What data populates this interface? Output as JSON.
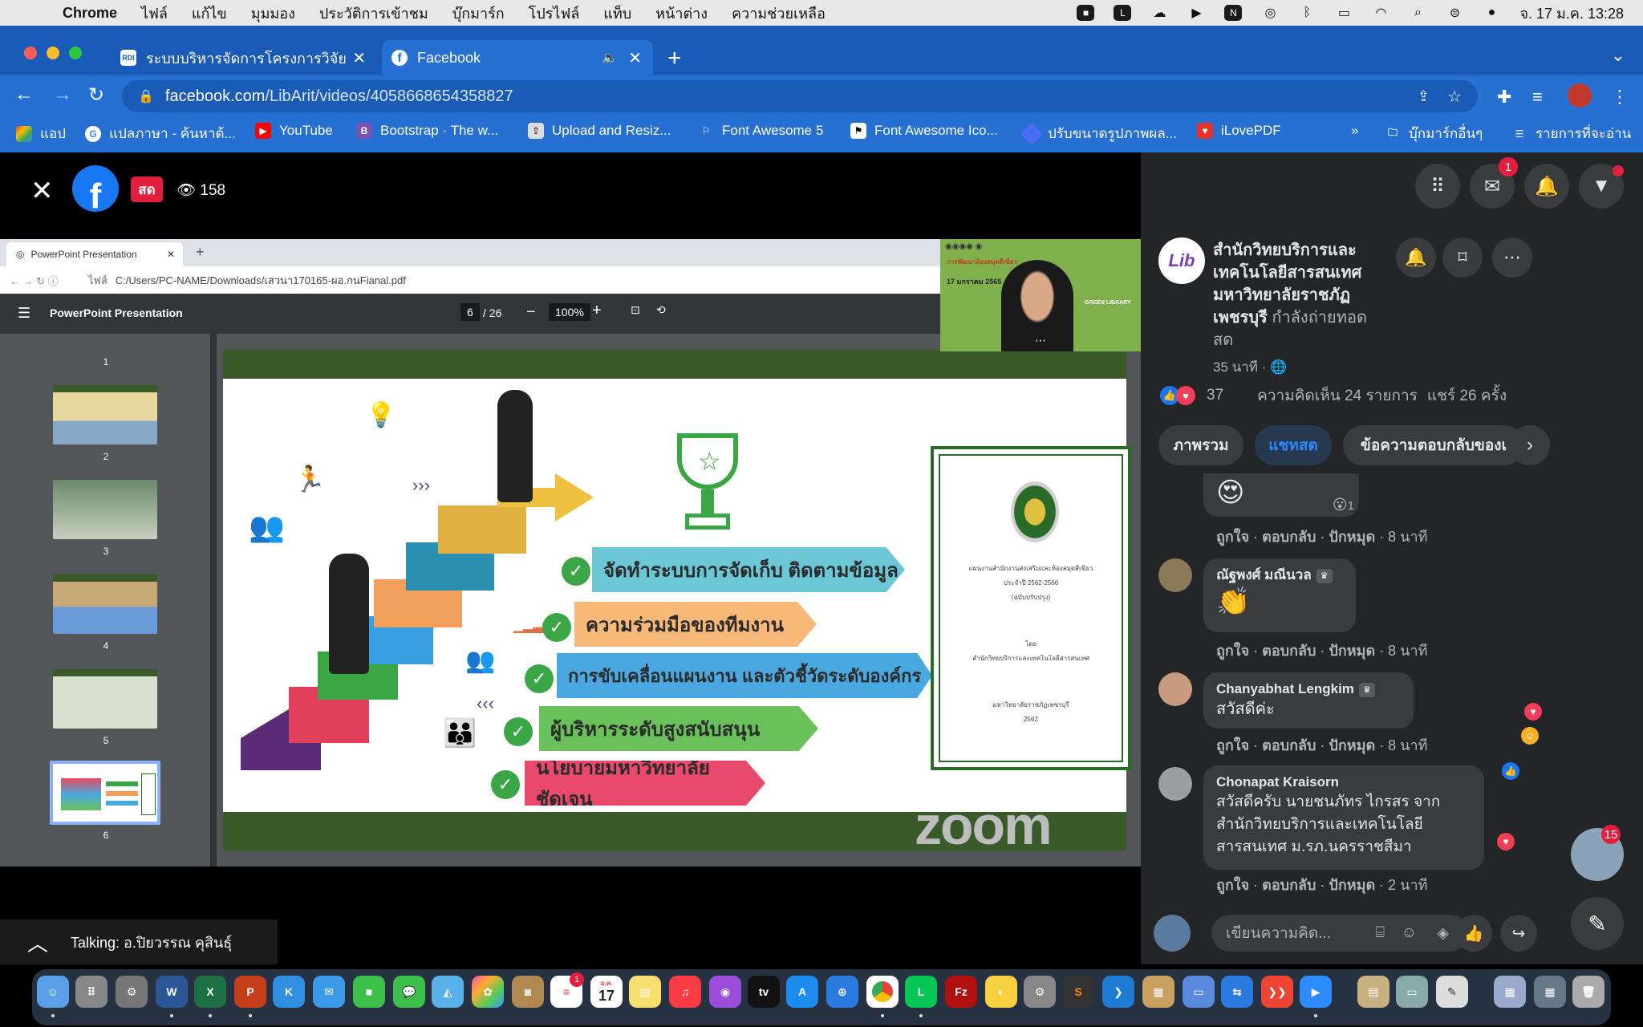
{
  "menubar": {
    "app": "Chrome",
    "items": [
      "ไฟล์",
      "แก้ไข",
      "มุมมอง",
      "ประวัติการเข้าชม",
      "บุ๊กมาร์ก",
      "โปรไฟล์",
      "แท็บ",
      "หน้าต่าง",
      "ความช่วยเหลือ"
    ],
    "clock": "จ. 17 ม.ค.  13:28"
  },
  "browser": {
    "tabs": [
      {
        "title": "ระบบบริหารจัดการโครงการวิจัย | ส",
        "favicon": "RDI"
      },
      {
        "title": "Facebook",
        "favicon": "f"
      }
    ],
    "url_host": "facebook.com",
    "url_path": "/LibArit/videos/4058668654358827",
    "bookmarks": [
      "แอป",
      "แปลภาษา - ค้นหาด้...",
      "YouTube",
      "Bootstrap · The w...",
      "Upload and Resiz...",
      "Font Awesome 5",
      "Font Awesome Ico...",
      "ปรับขนาดรูปภาพผล...",
      "iLovePDF",
      "»",
      "บุ๊กมาร์กอื่นๆ",
      "รายการที่จะอ่าน"
    ]
  },
  "video": {
    "live_label": "สด",
    "viewers": "158",
    "talking": "Talking: อ.ปิยวรรณ คุสินธุ์",
    "pdf": {
      "tab_title": "PowerPoint Presentation",
      "path_label": "ไฟล์",
      "path": "C:/Users/PC-NAME/Downloads/เสวนา170165-ผอ.กนFianal.pdf",
      "doc_title": "PowerPoint Presentation",
      "page": "6",
      "pages": "/ 26",
      "zoom": "100%",
      "thumb_numbers": [
        "1",
        "2",
        "3",
        "4",
        "5",
        "6"
      ]
    },
    "slide": {
      "items": [
        "จัดทำระบบการจัดเก็บ ติดตามข้อมูล",
        "ความร่วมมือของทีมงาน",
        "การขับเคลื่อนแผนงาน และตัวชี้วัดระดับองค์กร",
        "ผู้บริหารระดับสูงสนับสนุน",
        "นโยบายมหาวิทยาลัยชัดเจน"
      ],
      "report_lines": [
        "แผนงานสำนักงานส่งเสริมและห้องสมุดสีเขียว",
        "ประจำปี 2562-2566",
        "(ฉบับปรับปรุง)",
        "โดย",
        "สำนักวิทยบริการและเทคโนโลยีสารสนเทศ",
        "มหาวิทยาลัยราชภัฏเพชรบุรี",
        "2562"
      ],
      "watermark": "zoom"
    },
    "pip_date": "17 มกราคม 2565",
    "pip_title": "การพัฒนาห้องสมุดสีเขียว",
    "pip_tag": "GREEN LIBRARY"
  },
  "panel": {
    "messenger_badge": "1",
    "page_name": "สำนักวิทยบริการและเทคโนโลยีสารสนเทศ มหาวิทยาลัยราชภัฏเพชรบุรี",
    "page_status": " กำลังถ่ายทอดสด",
    "time": "35 นาที ·",
    "reactions_count": "37",
    "comments_count": "ความคิดเห็น 24 รายการ",
    "shares": "แชร์ 26 ครั้ง",
    "pills": [
      "ภาพรวม",
      "แชทสด",
      "ข้อความตอบกลับของเ"
    ],
    "comments": [
      {
        "name": "",
        "text": "😍",
        "reaction_count": "1",
        "actions": [
          "ถูกใจ",
          "ตอบกลับ",
          "ปักหมุด"
        ],
        "time": "8 นาที"
      },
      {
        "name": "ณัฐพงศ์ มณีนวล",
        "text": "👏",
        "actions": [
          "ถูกใจ",
          "ตอบกลับ",
          "ปักหมุด"
        ],
        "time": "8 นาที"
      },
      {
        "name": "Chanyabhat Lengkim",
        "text": "สวัสดีค่ะ",
        "actions": [
          "ถูกใจ",
          "ตอบกลับ",
          "ปักหมุด"
        ],
        "time": "8 นาที"
      },
      {
        "name": "Chonapat Kraisorn",
        "text": "สวัสดีครับ นายชนภัทร ไกรสร จาก สำนักวิทยบริการและเทคโนโลยี สารสนเทศ ม.รภ.นครราชสีมา",
        "actions": [
          "ถูกใจ",
          "ตอบกลับ",
          "ปักหมุด"
        ],
        "time": "2 นาที"
      }
    ],
    "composer_placeholder": "เขียนความคิด...",
    "float_badge": "15"
  },
  "dock": {
    "calendar_month": "ม.ค.",
    "calendar_day": "17",
    "reminder_badge": "1",
    "tv_label": "tv"
  },
  "colors": {
    "chrome_blue": "#2670d4",
    "fb_blue": "#1877f2",
    "live_red": "#e41e3f",
    "panel_bg": "#242526"
  }
}
